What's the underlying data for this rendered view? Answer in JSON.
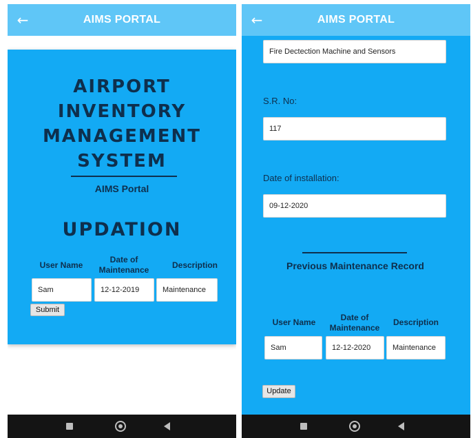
{
  "app": {
    "title": "AIMS PORTAL",
    "back_glyph": "←"
  },
  "left": {
    "title_lines": [
      "AIRPORT",
      "INVENTORY",
      "MANAGEMENT",
      "SYSTEM"
    ],
    "subtitle": "AIMS Portal",
    "section_title": "UPDATION",
    "table": {
      "headers": [
        "User Name",
        "Date of Maintenance",
        "Description"
      ],
      "values": [
        "Sam",
        "12-12-2019",
        "Maintenance"
      ]
    },
    "submit_label": "Submit"
  },
  "right": {
    "equipment_value": "Fire Dectection Machine and Sensors",
    "sr_label": "S.R. No:",
    "sr_value": "117",
    "install_label": "Date of installation:",
    "install_value": "09-12-2020",
    "record_title": "Previous Maintenance Record",
    "table": {
      "headers": [
        "User Name",
        "Date of Maintenance",
        "Description"
      ],
      "values": [
        "Sam",
        "12-12-2020",
        "Maintenance"
      ]
    },
    "update_label": "Update"
  },
  "icons": {
    "back": "arrow-left-icon",
    "nav_recents": "square-icon",
    "nav_home": "circle-icon",
    "nav_back": "triangle-back-icon"
  },
  "colors": {
    "app_bar": "#5fc6f7",
    "panel": "#13aaf4",
    "heading_text": "#0e2f4d",
    "nav_bar": "#141414"
  }
}
